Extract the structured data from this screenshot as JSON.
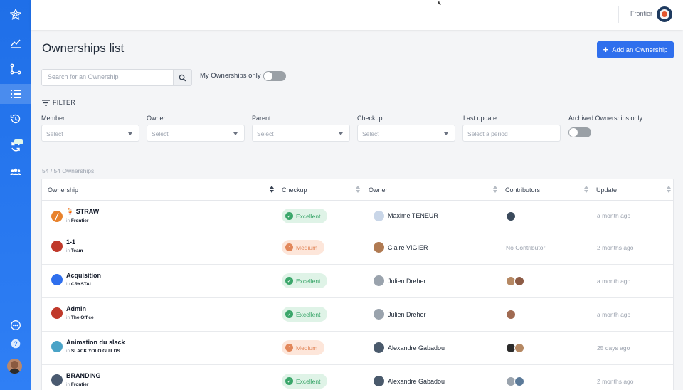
{
  "topbar": {
    "org_name": "Frontier"
  },
  "page": {
    "title": "Ownerships list",
    "add_button": "Add an Ownership",
    "search_placeholder": "Search for an Ownership",
    "my_ownerships_label": "My Ownerships only",
    "filter_label": "FILTER",
    "count_label": "54 / 54 Ownerships"
  },
  "filters": {
    "member": {
      "label": "Member",
      "value": "Select"
    },
    "owner": {
      "label": "Owner",
      "value": "Select"
    },
    "parent": {
      "label": "Parent",
      "value": "Select"
    },
    "checkup": {
      "label": "Checkup",
      "value": "Select"
    },
    "last_update": {
      "label": "Last update",
      "placeholder": "Select a period"
    },
    "archived": {
      "label": "Archived Ownerships only"
    }
  },
  "table": {
    "columns": [
      "Ownership",
      "Checkup",
      "Owner",
      "Contributors",
      "Update"
    ],
    "rows": [
      {
        "name": "🍹 STRAW",
        "in_prefix": "in",
        "parent": "Frontier",
        "color": "#e8822c",
        "checkup": "Excellent",
        "owner": "Maxime TENEUR",
        "contributors": "",
        "update": "a month ago"
      },
      {
        "name": "1-1",
        "in_prefix": "in",
        "parent": "Team",
        "color": "#c0392b",
        "checkup": "Medium",
        "owner": "Claire VIGIER",
        "contributors": "No Contributor",
        "update": "2 months ago"
      },
      {
        "name": "Acquisition",
        "in_prefix": "in",
        "parent": "CRYSTAL",
        "color": "#2f6fed",
        "checkup": "Excellent",
        "owner": "Julien Dreher",
        "contributors": "",
        "update": "a month ago"
      },
      {
        "name": "Admin",
        "in_prefix": "in",
        "parent": "The Office",
        "color": "#c0392b",
        "checkup": "Excellent",
        "owner": "Julien Dreher",
        "contributors": "",
        "update": "a month ago"
      },
      {
        "name": "Animation du slack",
        "in_prefix": "in",
        "parent": "SLACK YOLO GUILDS",
        "color": "#4aa3c7",
        "checkup": "Medium",
        "owner": "Alexandre Gabadou",
        "contributors": "",
        "update": "25 days ago"
      },
      {
        "name": "BRANDING",
        "in_prefix": "in",
        "parent": "Frontier",
        "color": "#4a5a70",
        "checkup": "Excellent",
        "owner": "Alexandre Gabadou",
        "contributors": "",
        "update": "2 months ago"
      }
    ]
  },
  "colors": {
    "accent": "#2f6fed",
    "excellent": "#3aa66a",
    "medium": "#e2875a"
  },
  "icons": [
    "logo-icon",
    "chart-icon",
    "branch-icon",
    "list-icon",
    "history-icon",
    "sync-icon",
    "team-icon",
    "chat-icon",
    "help-icon"
  ]
}
